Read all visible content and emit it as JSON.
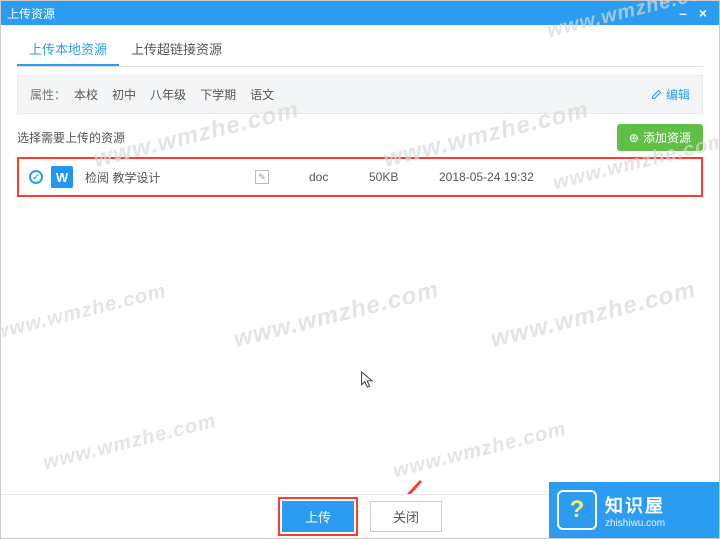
{
  "window": {
    "title": "上传资源",
    "min": "–",
    "close": "×"
  },
  "tabs": {
    "local": "上传本地资源",
    "hyperlink": "上传超链接资源"
  },
  "attrs": {
    "label": "属性：",
    "crumbs": [
      "本校",
      "初中",
      "八年级",
      "下学期",
      "语文"
    ],
    "edit_label": "编辑"
  },
  "select": {
    "label": "选择需要上传的资源",
    "add_btn": "添加资源"
  },
  "file": {
    "icon_letter": "W",
    "name": "检阅 教学设计",
    "type": "doc",
    "size": "50KB",
    "date": "2018-05-24 19:32"
  },
  "footer": {
    "upload": "上传",
    "close": "关闭"
  },
  "logo": {
    "mark": "?",
    "title": "知识屋",
    "sub": "zhishiwu.com"
  },
  "watermark": "www.wmzhe.com"
}
